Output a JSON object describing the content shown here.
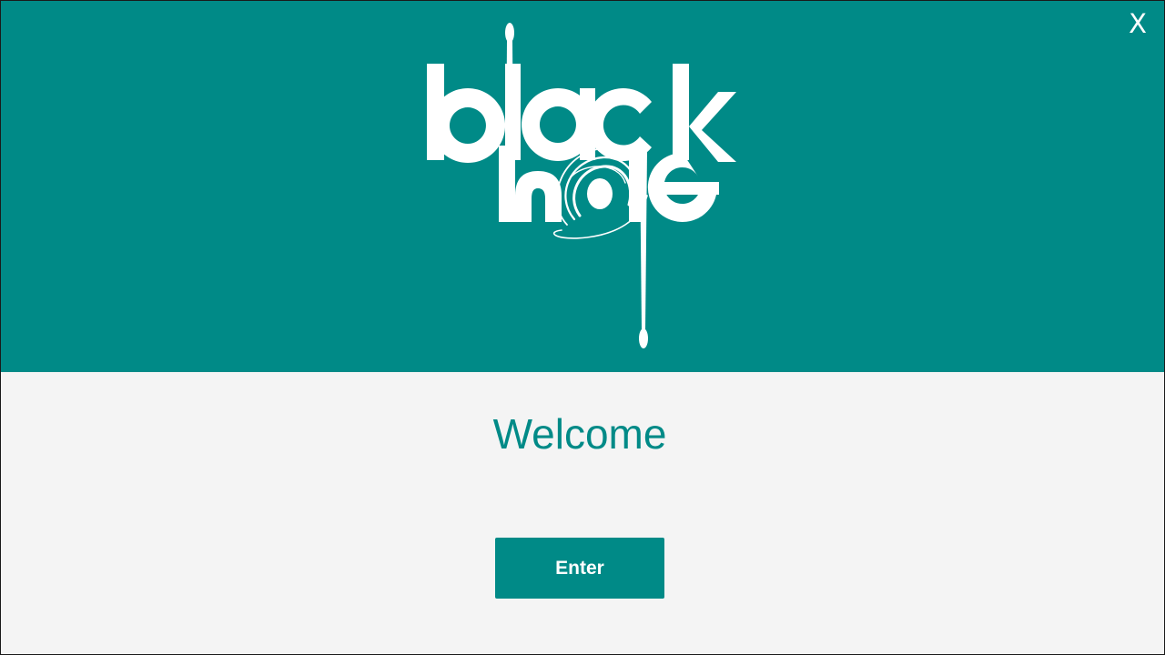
{
  "window": {
    "close_label": "X"
  },
  "logo": {
    "icon": "black-hole-drumstick-logo",
    "wordmark_line1": "black",
    "wordmark_line2": "hole",
    "color": "#ffffff"
  },
  "main": {
    "welcome_text": "Welcome",
    "enter_label": "Enter"
  },
  "colors": {
    "accent": "#008a87",
    "background": "#f4f4f4",
    "on_accent": "#ffffff"
  }
}
